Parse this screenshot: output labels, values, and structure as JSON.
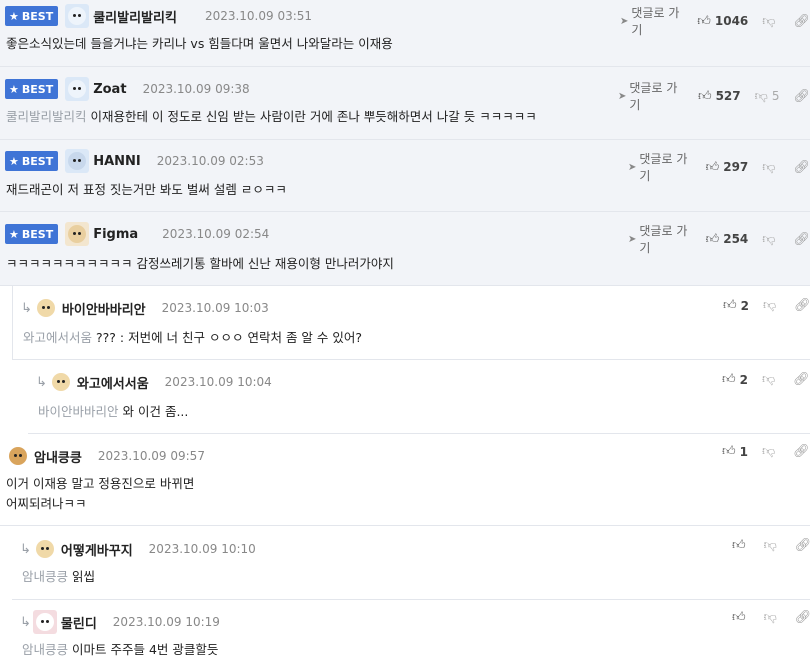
{
  "labels": {
    "best": "BEST",
    "reply": "댓글로 가기"
  },
  "comments": [
    {
      "nick": "쿨리발리발리킥",
      "date": "2023.10.09 03:51",
      "likes": "1046",
      "dislikes": "",
      "text": "좋은소식있는데 들을거냐는 카리나 vs 힘들다며 울면서 나와달라는 이재용",
      "mention": ""
    },
    {
      "nick": "Zoat",
      "date": "2023.10.09 09:38",
      "likes": "527",
      "dislikes": "5",
      "text": "이재용한테 이 정도로 신임 받는 사람이란 거에 존나 뿌듯해하면서 나갈 듯 ㅋㅋㅋㅋㅋ",
      "mention": "쿨리발리발리킥"
    },
    {
      "nick": "HANNI",
      "date": "2023.10.09 02:53",
      "likes": "297",
      "dislikes": "",
      "text": "재드래곤이 저 표정 짓는거만 봐도 벌써 설렘 ㄹㅇㅋㅋ",
      "mention": ""
    },
    {
      "nick": "Figma",
      "date": "2023.10.09 02:54",
      "likes": "254",
      "dislikes": "",
      "text": "ㅋㅋㅋㅋㅋㅋㅋㅋㅋㅋㅋ 감정쓰레기통 할바에 신난 재용이형 만나러가야지",
      "mention": ""
    },
    {
      "nick": "바이안바바리안",
      "date": "2023.10.09 10:03",
      "likes": "2",
      "dislikes": "",
      "text": "??? : 저번에 너 친구 ㅇㅇㅇ 연락처 좀 알 수 있어?",
      "mention": "와고에서서움"
    },
    {
      "nick": "와고에서서움",
      "date": "2023.10.09 10:04",
      "likes": "2",
      "dislikes": "",
      "text": "와 이건 좀...",
      "mention": "바이안바바리안"
    },
    {
      "nick": "암내킁킁",
      "date": "2023.10.09 09:57",
      "likes": "1",
      "dislikes": "",
      "text": "이거 이재용 말고 정용진으로 바뀌면",
      "text2": "어찌되려나ㅋㅋ",
      "mention": ""
    },
    {
      "nick": "어떻게바꾸지",
      "date": "2023.10.09 10:10",
      "likes": "",
      "dislikes": "",
      "text": "읽씹",
      "mention": "암내킁킁"
    },
    {
      "nick": "물린디",
      "date": "2023.10.09 10:19",
      "likes": "",
      "dislikes": "",
      "text": "이마트 주주들 4번 광클할듯",
      "mention": "암내킁킁"
    }
  ]
}
